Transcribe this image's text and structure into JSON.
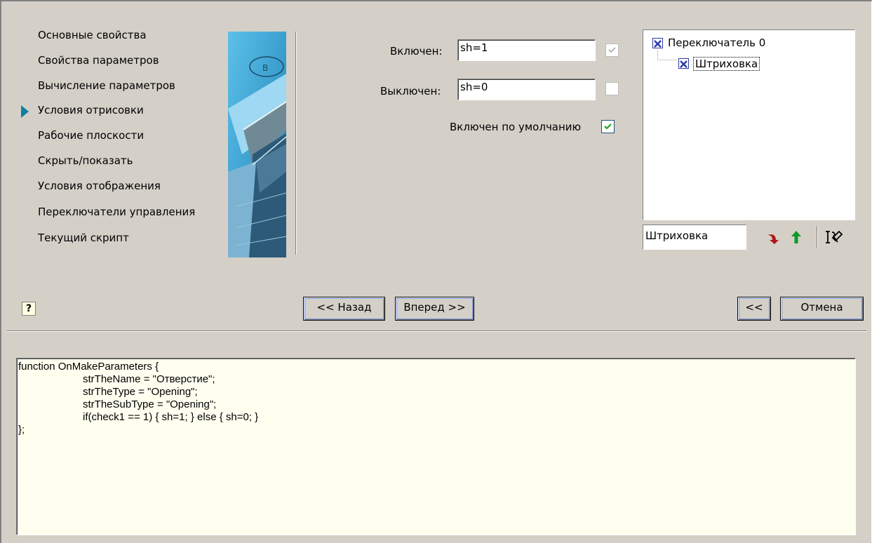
{
  "nav": {
    "items": [
      {
        "label": "Основные свойства",
        "active": false
      },
      {
        "label": "Свойства параметров",
        "active": false
      },
      {
        "label": "Вычисление параметров",
        "active": false
      },
      {
        "label": "Условия отрисовки",
        "active": true
      },
      {
        "label": "Рабочие плоскости",
        "active": false
      },
      {
        "label": "Скрыть/показать",
        "active": false
      },
      {
        "label": "Условия отображения",
        "active": false
      },
      {
        "label": "Переключатели управления",
        "active": false
      },
      {
        "label": "Текущий скрипт",
        "active": false
      }
    ]
  },
  "params": {
    "on_label": "Включен:",
    "on_value": "sh=1",
    "on_checked": true,
    "off_label": "Выключен:",
    "off_value": "sh=0",
    "off_checked": false,
    "default_label": "Включен по умолчанию",
    "default_checked": true
  },
  "tree": {
    "root": {
      "label": "Переключатель 0",
      "checked": true
    },
    "child": {
      "label": "Штриховка",
      "checked": true,
      "selected": true
    }
  },
  "name_input": {
    "value": "Штриховка"
  },
  "tools": {
    "down_icon": "arrow-down-icon",
    "up_icon": "arrow-up-icon",
    "rename_icon": "rename-icon"
  },
  "buttons": {
    "back": "<< Назад",
    "next": "Вперед >>",
    "collapse": "<<",
    "cancel": "Отмена"
  },
  "help": {
    "glyph": "?"
  },
  "code": {
    "lines": [
      "function OnMakeParameters {",
      "\t\tstrTheName = \"Отверстие\";",
      "\t\tstrTheType = \"Opening\";",
      "\t\tstrTheSubType = \"Opening\";",
      "\t\tif(check1 == 1) { sh=1; } else { sh=0; }",
      "};"
    ]
  },
  "colors": {
    "window_bg": "#d4d0c8",
    "nav_arrow": "#0f7fa0",
    "code_bg": "#fffff0",
    "check_green": "#1fa51f",
    "tree_x": "#2a3aa8"
  }
}
